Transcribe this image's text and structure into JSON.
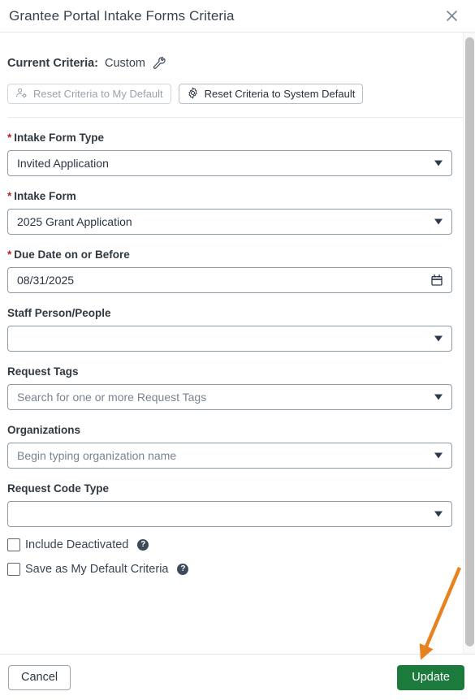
{
  "dialog": {
    "title": "Grantee Portal Intake Forms Criteria",
    "close_icon": "close-icon"
  },
  "criteria": {
    "label": "Current Criteria:",
    "value": "Custom",
    "wrench_icon": "wrench-icon",
    "reset_my_default": {
      "label": "Reset Criteria to My Default",
      "icon": "user-gear-icon",
      "disabled": true
    },
    "reset_system_default": {
      "label": "Reset Criteria to System Default",
      "icon": "gear-icon",
      "disabled": false
    }
  },
  "fields": {
    "intake_form_type": {
      "label": "Intake Form Type",
      "required": true,
      "value": "Invited Application",
      "placeholder": ""
    },
    "intake_form": {
      "label": "Intake Form",
      "required": true,
      "value": "2025 Grant Application",
      "placeholder": ""
    },
    "due_date": {
      "label": "Due Date on or Before",
      "required": true,
      "value": "08/31/2025",
      "icon": "calendar-icon"
    },
    "staff_person": {
      "label": "Staff Person/People",
      "required": false,
      "value": "",
      "placeholder": ""
    },
    "request_tags": {
      "label": "Request Tags",
      "required": false,
      "value": "",
      "placeholder": "Search for one or more Request Tags"
    },
    "organizations": {
      "label": "Organizations",
      "required": false,
      "value": "",
      "placeholder": "Begin typing organization name"
    },
    "request_code_type": {
      "label": "Request Code Type",
      "required": false,
      "value": "",
      "placeholder": ""
    }
  },
  "checkboxes": {
    "include_deactivated": {
      "label": "Include Deactivated",
      "checked": false,
      "help": "?"
    },
    "save_default": {
      "label": "Save as My Default Criteria",
      "checked": false,
      "help": "?"
    }
  },
  "footer": {
    "cancel_label": "Cancel",
    "update_label": "Update"
  },
  "colors": {
    "update_green": "#1d7a3d",
    "required_red": "#b02a1f",
    "annotation_orange": "#e8821e",
    "field_border": "#8d9aa8",
    "title_text": "#38434f"
  },
  "annotation": {
    "type": "arrow",
    "color": "#e8821e",
    "points_to": "Update"
  },
  "required_marker": "*"
}
